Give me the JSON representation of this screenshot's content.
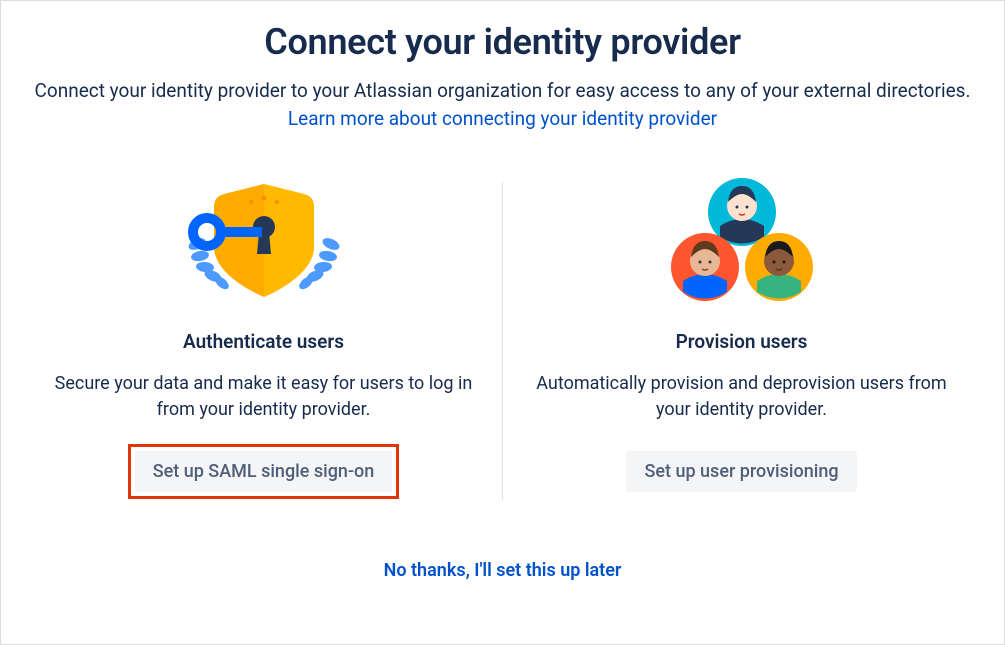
{
  "header": {
    "title": "Connect your identity provider",
    "subtitle_prefix": "Connect your identity provider to your Atlassian organization for easy access to any of your external directories. ",
    "subtitle_link": "Learn more about connecting your identity provider"
  },
  "cards": {
    "authenticate": {
      "title": "Authenticate users",
      "desc": "Secure your data and make it easy for users to log in from your identity provider.",
      "button": "Set up SAML single sign-on"
    },
    "provision": {
      "title": "Provision users",
      "desc": "Automatically provision and deprovision users from your identity provider.",
      "button": "Set up user provisioning"
    }
  },
  "footer": {
    "skip_link": "No thanks, I'll set this up later"
  }
}
